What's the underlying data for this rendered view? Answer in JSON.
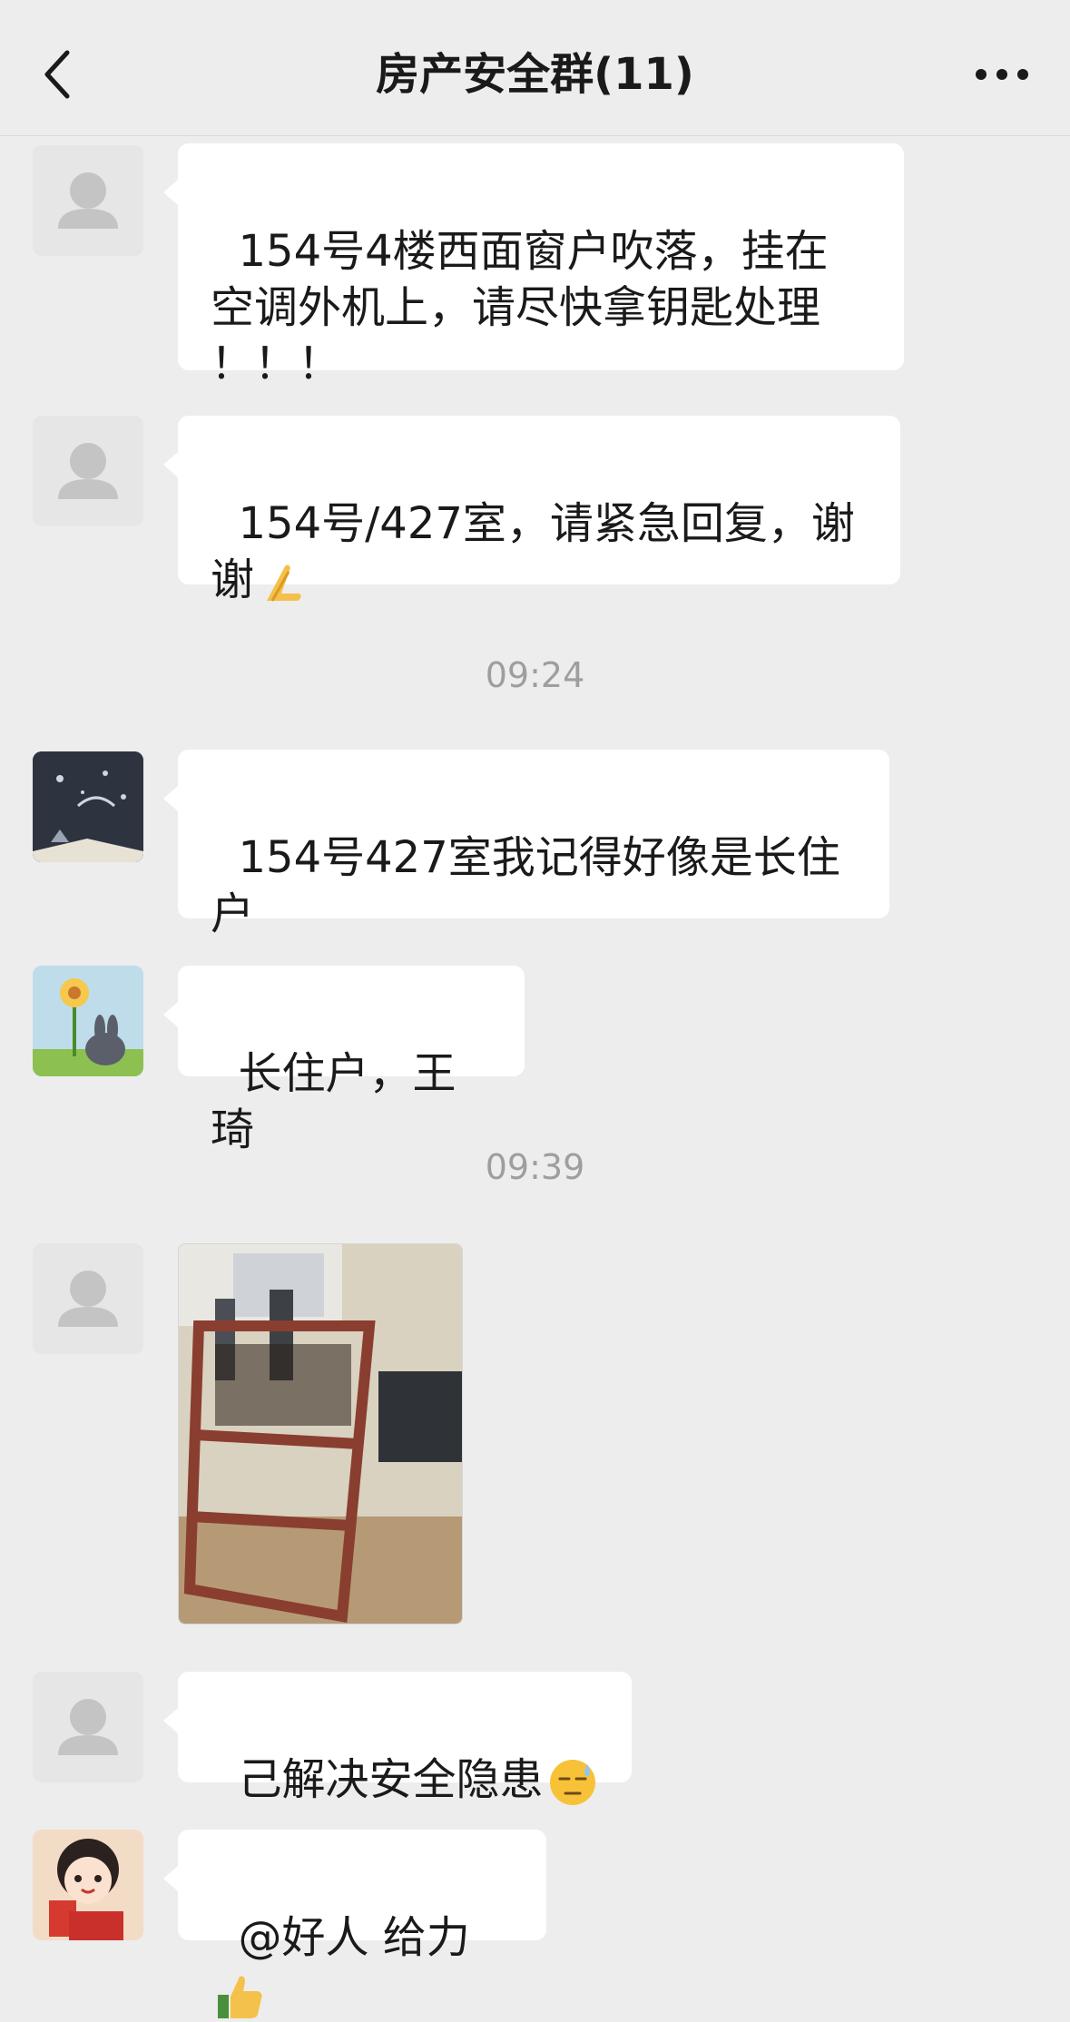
{
  "header": {
    "title": "房产安全群(11)",
    "back_icon": "chevron-left-icon",
    "more_icon": "more-dots-icon"
  },
  "messages": [
    {
      "avatar": "default-avatar",
      "text": "154号4楼西面窗户吹落，挂在\n空调外机上，请尽快拿钥匙处理\n！！！"
    },
    {
      "avatar": "default-avatar",
      "text": "154号/427室，请紧急回复，谢\n谢",
      "emoji": "folded-hands-emoji"
    },
    {
      "avatar": "night-sky-book-avatar",
      "text": "154号427室我记得好像是长住\n户"
    },
    {
      "avatar": "flower-bunny-avatar",
      "text": "长住户，王琦"
    },
    {
      "avatar": "default-avatar",
      "image": "window-frame-photo"
    },
    {
      "avatar": "default-avatar",
      "text": "己解决安全隐患",
      "emoji": "downcast-sweat-emoji"
    },
    {
      "avatar": "cartoon-girl-avatar",
      "text": "@好人 给力",
      "emoji": "thumbs-up-emoji"
    }
  ],
  "timestamps": [
    "09:24",
    "09:39"
  ]
}
